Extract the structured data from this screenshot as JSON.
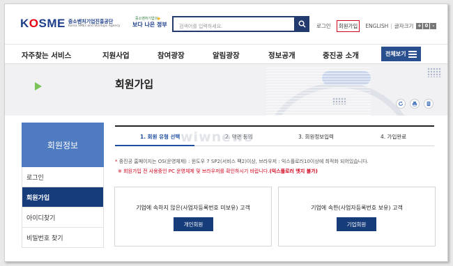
{
  "header": {
    "logo_text": "KOSME",
    "logo_korean": "중소벤처기업진흥공단",
    "logo_english": "Korea SMEs and Startups Agency",
    "slogan_top": "중소벤처기업의",
    "slogan_main": "보다 나은 정부",
    "search_placeholder": "검색어를 입력하세요.",
    "util": {
      "login": "로그인",
      "join": "회원가입",
      "english": "ENGLISH",
      "font_size": "글자크기",
      "font_plus": "+",
      "font_reset": "0",
      "font_minus": "-"
    }
  },
  "nav": {
    "items": [
      "자주찾는 서비스",
      "지원사업",
      "참여광장",
      "알림광장",
      "정보공개",
      "중진공 소개"
    ],
    "all_menu": "전체보기"
  },
  "banner": {
    "title": "회원가입"
  },
  "sidebar": {
    "title": "회원정보",
    "items": [
      {
        "label": "로그인",
        "active": false
      },
      {
        "label": "회원가입",
        "active": true
      },
      {
        "label": "아이디찾기",
        "active": false
      },
      {
        "label": "비밀번호 찾기",
        "active": false
      }
    ]
  },
  "steps": [
    {
      "label": "1. 회원 유형 선택",
      "active": true
    },
    {
      "label": "2. 약관 동의",
      "active": false
    },
    {
      "label": "3. 회원정보입력",
      "active": false
    },
    {
      "label": "4. 가입완료",
      "active": false
    }
  ],
  "watermark": "wiwnews",
  "notices": {
    "first": "중진공 홈페이지는 OS(운영체제) : 윈도우 7 SP2(서비스 팩2)이상, 브라우저 : 익스플로러10이상에 최적화 되어있습니다.",
    "second_prefix": "회원가입 전 사용중인 PC 운영체제 및 브라우저를 확인하시기 바랍니다.",
    "second_bold": "(익스플로러 엣지 불가)"
  },
  "cards": [
    {
      "title": "기업에 속하지 않은(사업자등록번호 미보유) 고객",
      "button": "개인회원"
    },
    {
      "title": "기업에 속한(사업자등록번호 보유) 고객",
      "button": "기업회원"
    }
  ],
  "colors": {
    "brand_navy": "#173c7a",
    "brand_blue": "#4f7bc0",
    "step_active": "#1d4ea0",
    "alert_red": "#d0021b"
  },
  "icons": [
    "search-icon",
    "hamburger-icon",
    "refresh-icon",
    "print-icon",
    "document-icon",
    "play-triangle-icon"
  ]
}
